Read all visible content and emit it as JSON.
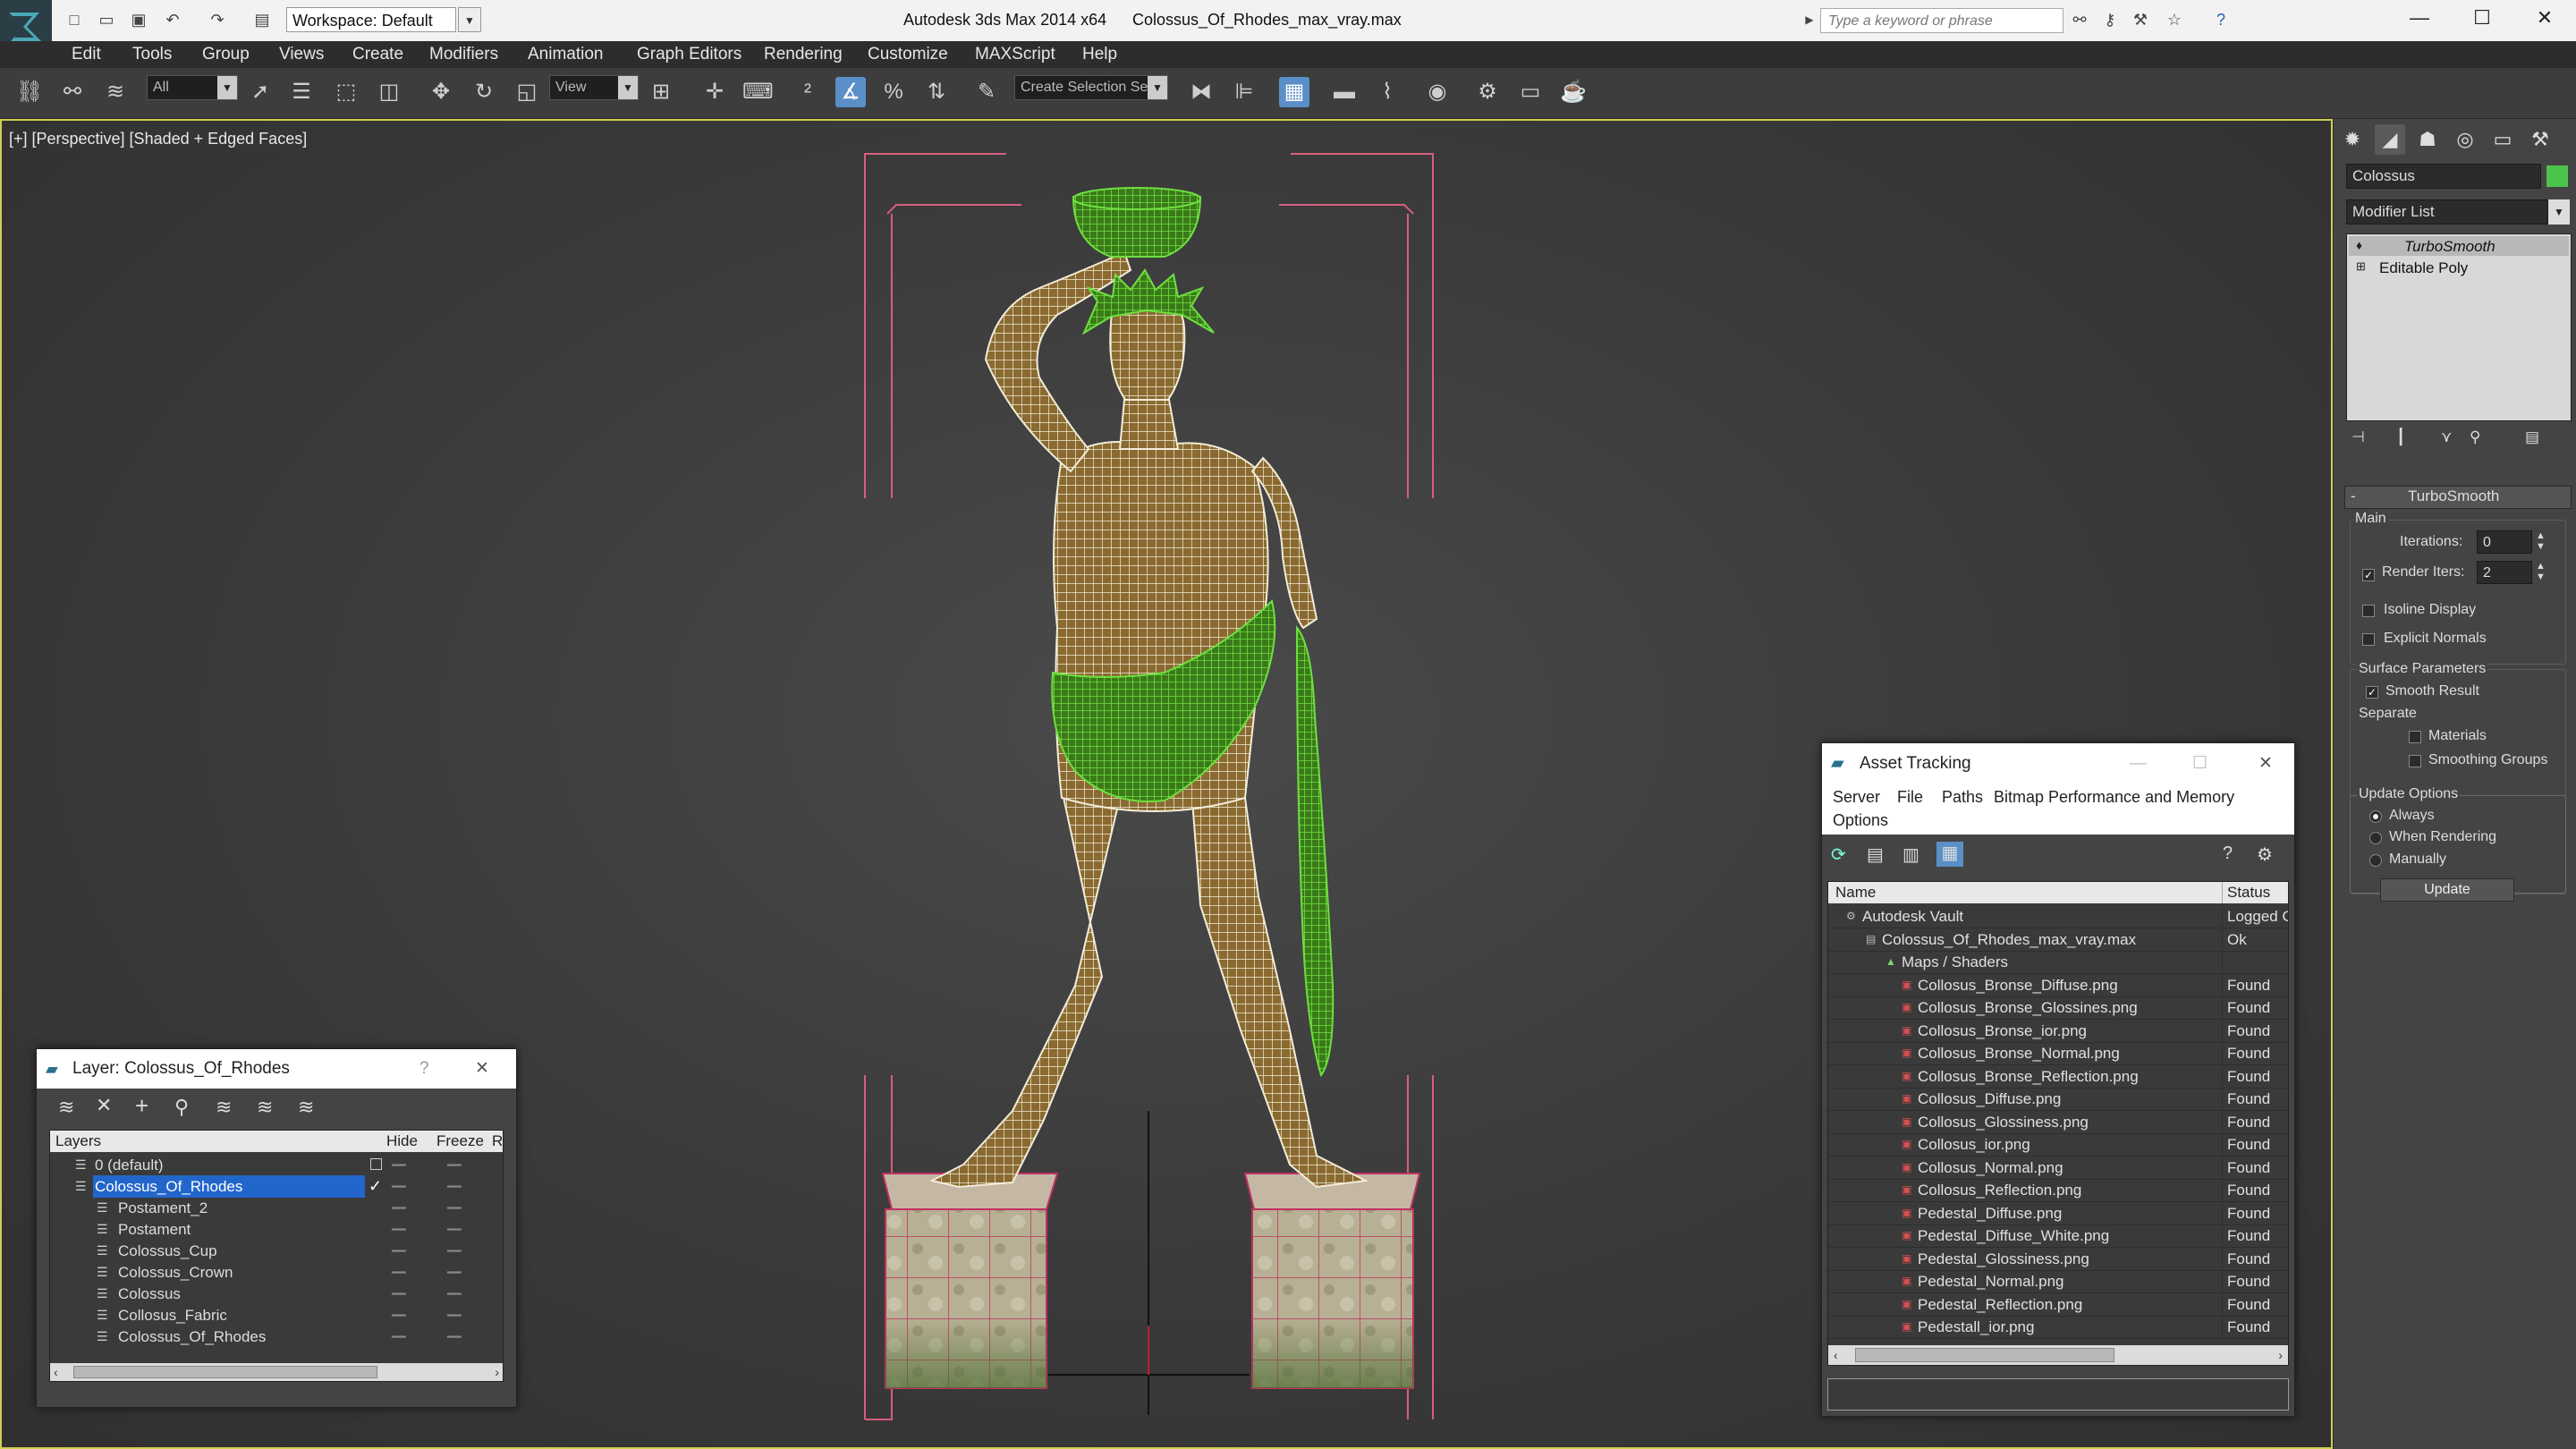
{
  "titlebar": {
    "app_title": "Autodesk 3ds Max 2014 x64",
    "file_title": "Colossus_Of_Rhodes_max_vray.max",
    "workspace": "Workspace: Default",
    "search_placeholder": "Type a keyword or phrase"
  },
  "menu": [
    "Edit",
    "Tools",
    "Group",
    "Views",
    "Create",
    "Modifiers",
    "Animation",
    "Graph Editors",
    "Rendering",
    "Customize",
    "MAXScript",
    "Help"
  ],
  "toolbar": {
    "filter_value": "All",
    "ref_coord_value": "View",
    "selection_set_placeholder": "Create Selection Se"
  },
  "viewport": {
    "label": "[+] [Perspective] [Shaded + Edged Faces]"
  },
  "command_panel": {
    "object_name": "Colossus",
    "object_color": "#4cc44c",
    "modifier_list_label": "Modifier List",
    "stack": [
      "TurboSmooth",
      "Editable Poly"
    ],
    "rollout_title": "TurboSmooth",
    "main_label": "Main",
    "iterations_label": "Iterations:",
    "iterations_value": "0",
    "render_iters_label": "Render Iters:",
    "render_iters_value": "2",
    "isoline_label": "Isoline Display",
    "explicit_normals_label": "Explicit Normals",
    "surface_params_label": "Surface Parameters",
    "smooth_result_label": "Smooth Result",
    "separate_label": "Separate",
    "materials_label": "Materials",
    "smoothing_groups_label": "Smoothing Groups",
    "update_options_label": "Update Options",
    "always_label": "Always",
    "when_rendering_label": "When Rendering",
    "manually_label": "Manually",
    "update_button": "Update"
  },
  "layer_window": {
    "title": "Layer: Colossus_Of_Rhodes",
    "help_glyph": "?",
    "col_layers": "Layers",
    "col_hide": "Hide",
    "col_freeze": "Freeze",
    "col_r": "R",
    "rows": [
      {
        "name": "0 (default)",
        "level": 0
      },
      {
        "name": "Colossus_Of_Rhodes",
        "level": 0
      },
      {
        "name": "Postament_2",
        "level": 1
      },
      {
        "name": "Postament",
        "level": 1
      },
      {
        "name": "Colossus_Cup",
        "level": 1
      },
      {
        "name": "Colossus_Crown",
        "level": 1
      },
      {
        "name": "Colossus",
        "level": 1
      },
      {
        "name": "Collosus_Fabric",
        "level": 1
      },
      {
        "name": "Colossus_Of_Rhodes",
        "level": 1
      }
    ]
  },
  "asset_window": {
    "title": "Asset Tracking",
    "menu": [
      "Server",
      "File",
      "Paths",
      "Bitmap Performance and Memory",
      "Options"
    ],
    "col_name": "Name",
    "col_status": "Status",
    "rows": [
      {
        "name": "Autodesk Vault",
        "status": "Logged O",
        "level": 0
      },
      {
        "name": "Colossus_Of_Rhodes_max_vray.max",
        "status": "Ok",
        "level": 1
      },
      {
        "name": "Maps / Shaders",
        "status": "",
        "level": 2
      },
      {
        "name": "Collosus_Bronse_Diffuse.png",
        "status": "Found",
        "level": 3
      },
      {
        "name": "Collosus_Bronse_Glossines.png",
        "status": "Found",
        "level": 3
      },
      {
        "name": "Collosus_Bronse_ior.png",
        "status": "Found",
        "level": 3
      },
      {
        "name": "Collosus_Bronse_Normal.png",
        "status": "Found",
        "level": 3
      },
      {
        "name": "Collosus_Bronse_Reflection.png",
        "status": "Found",
        "level": 3
      },
      {
        "name": "Collosus_Diffuse.png",
        "status": "Found",
        "level": 3
      },
      {
        "name": "Collosus_Glossiness.png",
        "status": "Found",
        "level": 3
      },
      {
        "name": "Collosus_ior.png",
        "status": "Found",
        "level": 3
      },
      {
        "name": "Collosus_Normal.png",
        "status": "Found",
        "level": 3
      },
      {
        "name": "Collosus_Reflection.png",
        "status": "Found",
        "level": 3
      },
      {
        "name": "Pedestal_Diffuse.png",
        "status": "Found",
        "level": 3
      },
      {
        "name": "Pedestal_Diffuse_White.png",
        "status": "Found",
        "level": 3
      },
      {
        "name": "Pedestal_Glossiness.png",
        "status": "Found",
        "level": 3
      },
      {
        "name": "Pedestal_Normal.png",
        "status": "Found",
        "level": 3
      },
      {
        "name": "Pedestal_Reflection.png",
        "status": "Found",
        "level": 3
      },
      {
        "name": "Pedestall_ior.png",
        "status": "Found",
        "level": 3
      }
    ]
  }
}
